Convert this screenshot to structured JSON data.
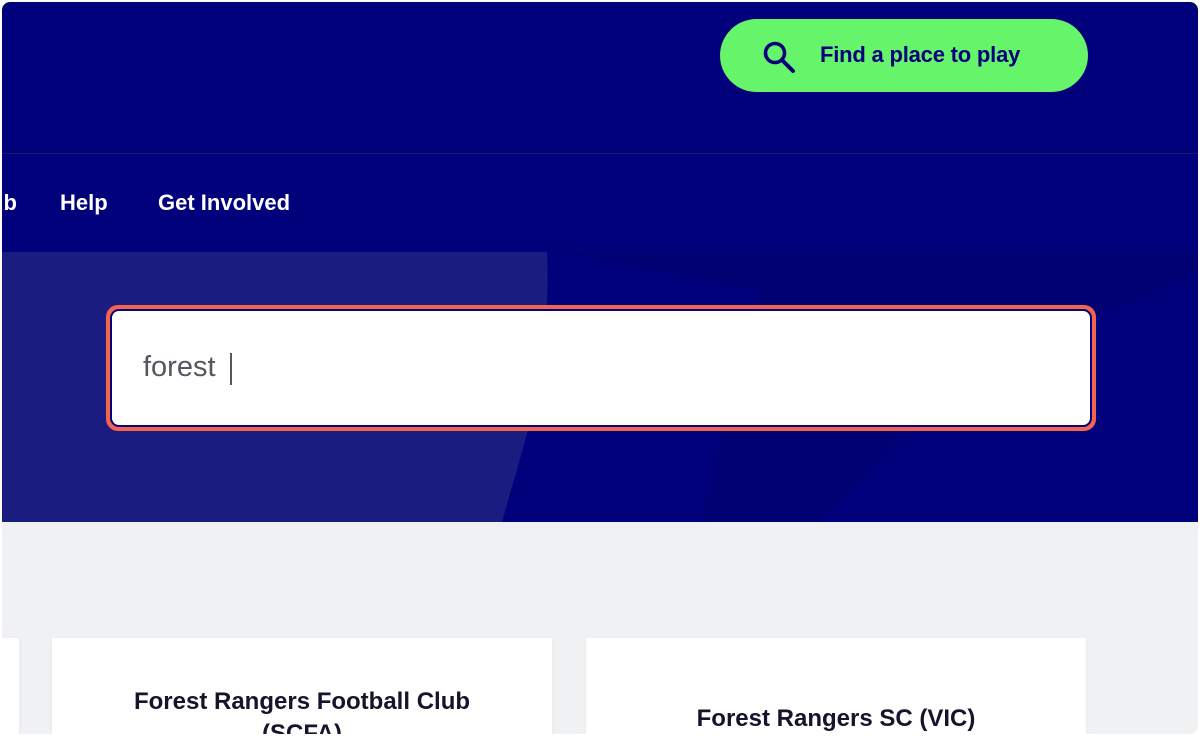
{
  "header": {
    "find_button_label": "Find a place to play",
    "find_button_icon": "search-icon",
    "background_color": "#01017c",
    "accent_color": "#66f46a"
  },
  "nav": {
    "items": [
      {
        "label": "ub"
      },
      {
        "label": "Help"
      },
      {
        "label": "Get Involved"
      }
    ]
  },
  "search": {
    "value": "forest",
    "focus_ring_color": "#f3634e"
  },
  "results": {
    "cards": [
      {
        "title_line1": "Forest Rangers Football Club",
        "title_line2": "(SCFA)"
      },
      {
        "title_line1": "Forest Rangers SC (VIC)"
      }
    ]
  }
}
